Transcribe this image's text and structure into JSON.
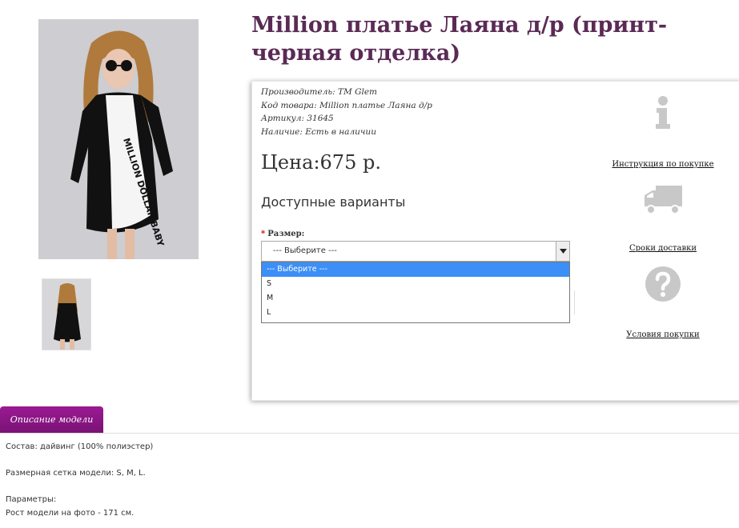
{
  "product": {
    "title": "Million платье Лаяна д/р (принт-черная отделка)",
    "main_image": "dress-photo",
    "thumbnail_image": "dress-back-photo"
  },
  "meta": {
    "manufacturer_label": "Производитель:",
    "manufacturer_value": "TM Glem",
    "code_label": "Код товара:",
    "code_value": "Million платье Лаяна д/р",
    "sku_label": "Артикул:",
    "sku_value": "31645",
    "stock_label": "Наличие:",
    "stock_value": "Есть в наличии"
  },
  "price": "Цена:675 р.",
  "options": {
    "heading": "Доступные варианты",
    "size_label": "Размер:",
    "required_mark": "*",
    "selected_value": "--- Выберите ---",
    "items": [
      "--- Выберите ---",
      "S",
      "M",
      "L"
    ]
  },
  "side_links": {
    "instructions": "Инструкция по покупке",
    "delivery": "Сроки доставки",
    "conditions": "Условия покупки",
    "icons": [
      "info-icon",
      "truck-icon",
      "question-icon"
    ]
  },
  "tabs": {
    "description": "Описание модели"
  },
  "description": {
    "composition": "Состав: дайвинг (100% полиэстер)",
    "sizes": "Размерная сетка модели: S, M, L.",
    "params_label": "Параметры:",
    "height": "Рост модели на фото - 171 см."
  },
  "colors": {
    "title": "#5a2a55",
    "tab": "#8e1787",
    "dropdown_selected": "#3b8ff7",
    "icon_gray": "#c8c8c8"
  }
}
